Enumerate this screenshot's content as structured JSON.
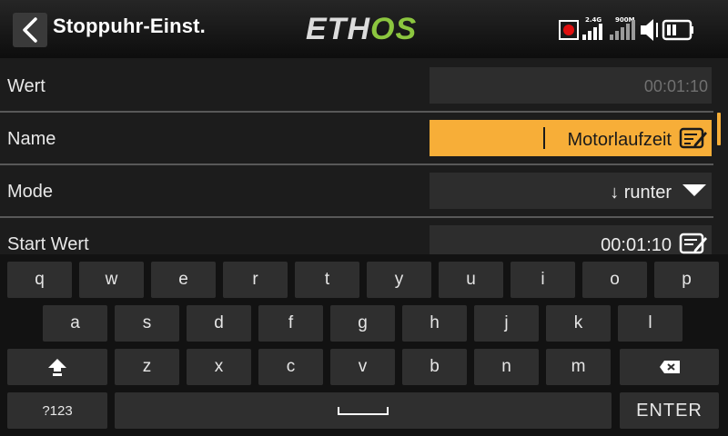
{
  "header": {
    "title": "Stoppuhr-Einst.",
    "logo_part1": "ETH",
    "logo_part2": "OS",
    "rssi_24": "2.4G",
    "rssi_900": "900M"
  },
  "settings": [
    {
      "label": "Wert",
      "value": "00:01:10",
      "type": "readonly"
    },
    {
      "label": "Name",
      "value": "Motorlaufzeit",
      "type": "text-active"
    },
    {
      "label": "Mode",
      "value": "↓ runter",
      "type": "choice"
    },
    {
      "label": "Start Wert",
      "value": "00:01:10",
      "type": "edit"
    }
  ],
  "keyboard": {
    "row1": [
      "q",
      "w",
      "e",
      "r",
      "t",
      "y",
      "u",
      "i",
      "o",
      "p"
    ],
    "row2": [
      "a",
      "s",
      "d",
      "f",
      "g",
      "h",
      "j",
      "k",
      "l"
    ],
    "row3": [
      "z",
      "x",
      "c",
      "v",
      "b",
      "n",
      "m"
    ],
    "sym_label": "?123",
    "enter_label": "ENTER"
  },
  "colors": {
    "accent": "#f7ae38",
    "logo_green": "#8cc63f",
    "record_red": "#e01010"
  },
  "icons": {
    "back": "chevron-left-icon",
    "record": "record-icon",
    "signal": "signal-bars-icon",
    "volume": "speaker-icon",
    "battery": "battery-icon",
    "edit": "edit-note-icon",
    "dropdown": "triangle-down-icon",
    "shift": "shift-icon",
    "backspace": "backspace-icon",
    "space": "space-icon"
  }
}
